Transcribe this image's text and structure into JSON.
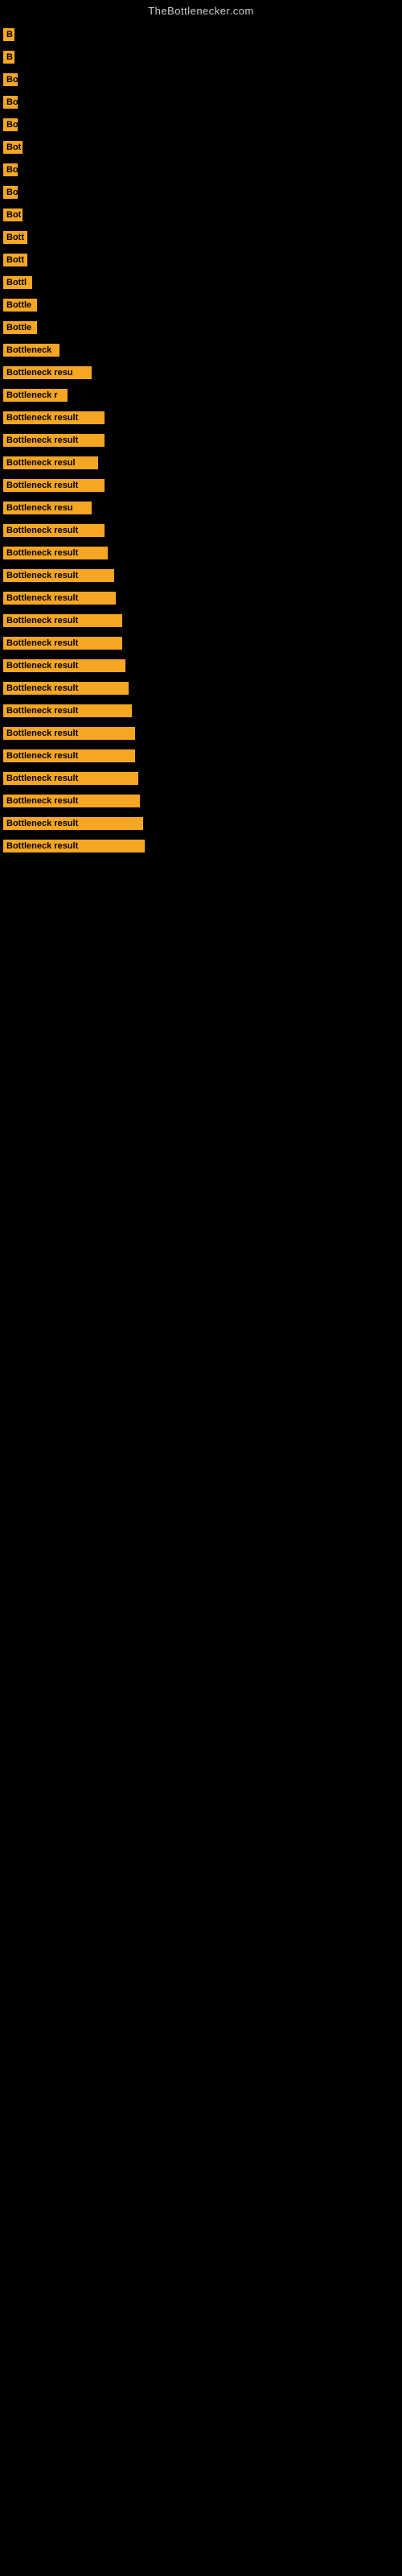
{
  "site_title": "TheBottlenecker.com",
  "bars": [
    {
      "id": 1,
      "label": "B",
      "width": 14
    },
    {
      "id": 2,
      "label": "B",
      "width": 14
    },
    {
      "id": 3,
      "label": "Bo",
      "width": 18
    },
    {
      "id": 4,
      "label": "Bo",
      "width": 18
    },
    {
      "id": 5,
      "label": "Bo",
      "width": 18
    },
    {
      "id": 6,
      "label": "Bot",
      "width": 24
    },
    {
      "id": 7,
      "label": "Bo",
      "width": 18
    },
    {
      "id": 8,
      "label": "Bo",
      "width": 18
    },
    {
      "id": 9,
      "label": "Bot",
      "width": 24
    },
    {
      "id": 10,
      "label": "Bott",
      "width": 30
    },
    {
      "id": 11,
      "label": "Bott",
      "width": 30
    },
    {
      "id": 12,
      "label": "Bottl",
      "width": 36
    },
    {
      "id": 13,
      "label": "Bottle",
      "width": 42
    },
    {
      "id": 14,
      "label": "Bottle",
      "width": 42
    },
    {
      "id": 15,
      "label": "Bottleneck",
      "width": 70
    },
    {
      "id": 16,
      "label": "Bottleneck resu",
      "width": 110
    },
    {
      "id": 17,
      "label": "Bottleneck r",
      "width": 80
    },
    {
      "id": 18,
      "label": "Bottleneck result",
      "width": 126
    },
    {
      "id": 19,
      "label": "Bottleneck result",
      "width": 126
    },
    {
      "id": 20,
      "label": "Bottleneck resul",
      "width": 118
    },
    {
      "id": 21,
      "label": "Bottleneck result",
      "width": 126
    },
    {
      "id": 22,
      "label": "Bottleneck resu",
      "width": 110
    },
    {
      "id": 23,
      "label": "Bottleneck result",
      "width": 126
    },
    {
      "id": 24,
      "label": "Bottleneck result",
      "width": 130
    },
    {
      "id": 25,
      "label": "Bottleneck result",
      "width": 138
    },
    {
      "id": 26,
      "label": "Bottleneck result",
      "width": 140
    },
    {
      "id": 27,
      "label": "Bottleneck result",
      "width": 148
    },
    {
      "id": 28,
      "label": "Bottleneck result",
      "width": 148
    },
    {
      "id": 29,
      "label": "Bottleneck result",
      "width": 152
    },
    {
      "id": 30,
      "label": "Bottleneck result",
      "width": 156
    },
    {
      "id": 31,
      "label": "Bottleneck result",
      "width": 160
    },
    {
      "id": 32,
      "label": "Bottleneck result",
      "width": 164
    },
    {
      "id": 33,
      "label": "Bottleneck result",
      "width": 164
    },
    {
      "id": 34,
      "label": "Bottleneck result",
      "width": 168
    },
    {
      "id": 35,
      "label": "Bottleneck result",
      "width": 170
    },
    {
      "id": 36,
      "label": "Bottleneck result",
      "width": 174
    },
    {
      "id": 37,
      "label": "Bottleneck result",
      "width": 176
    }
  ]
}
